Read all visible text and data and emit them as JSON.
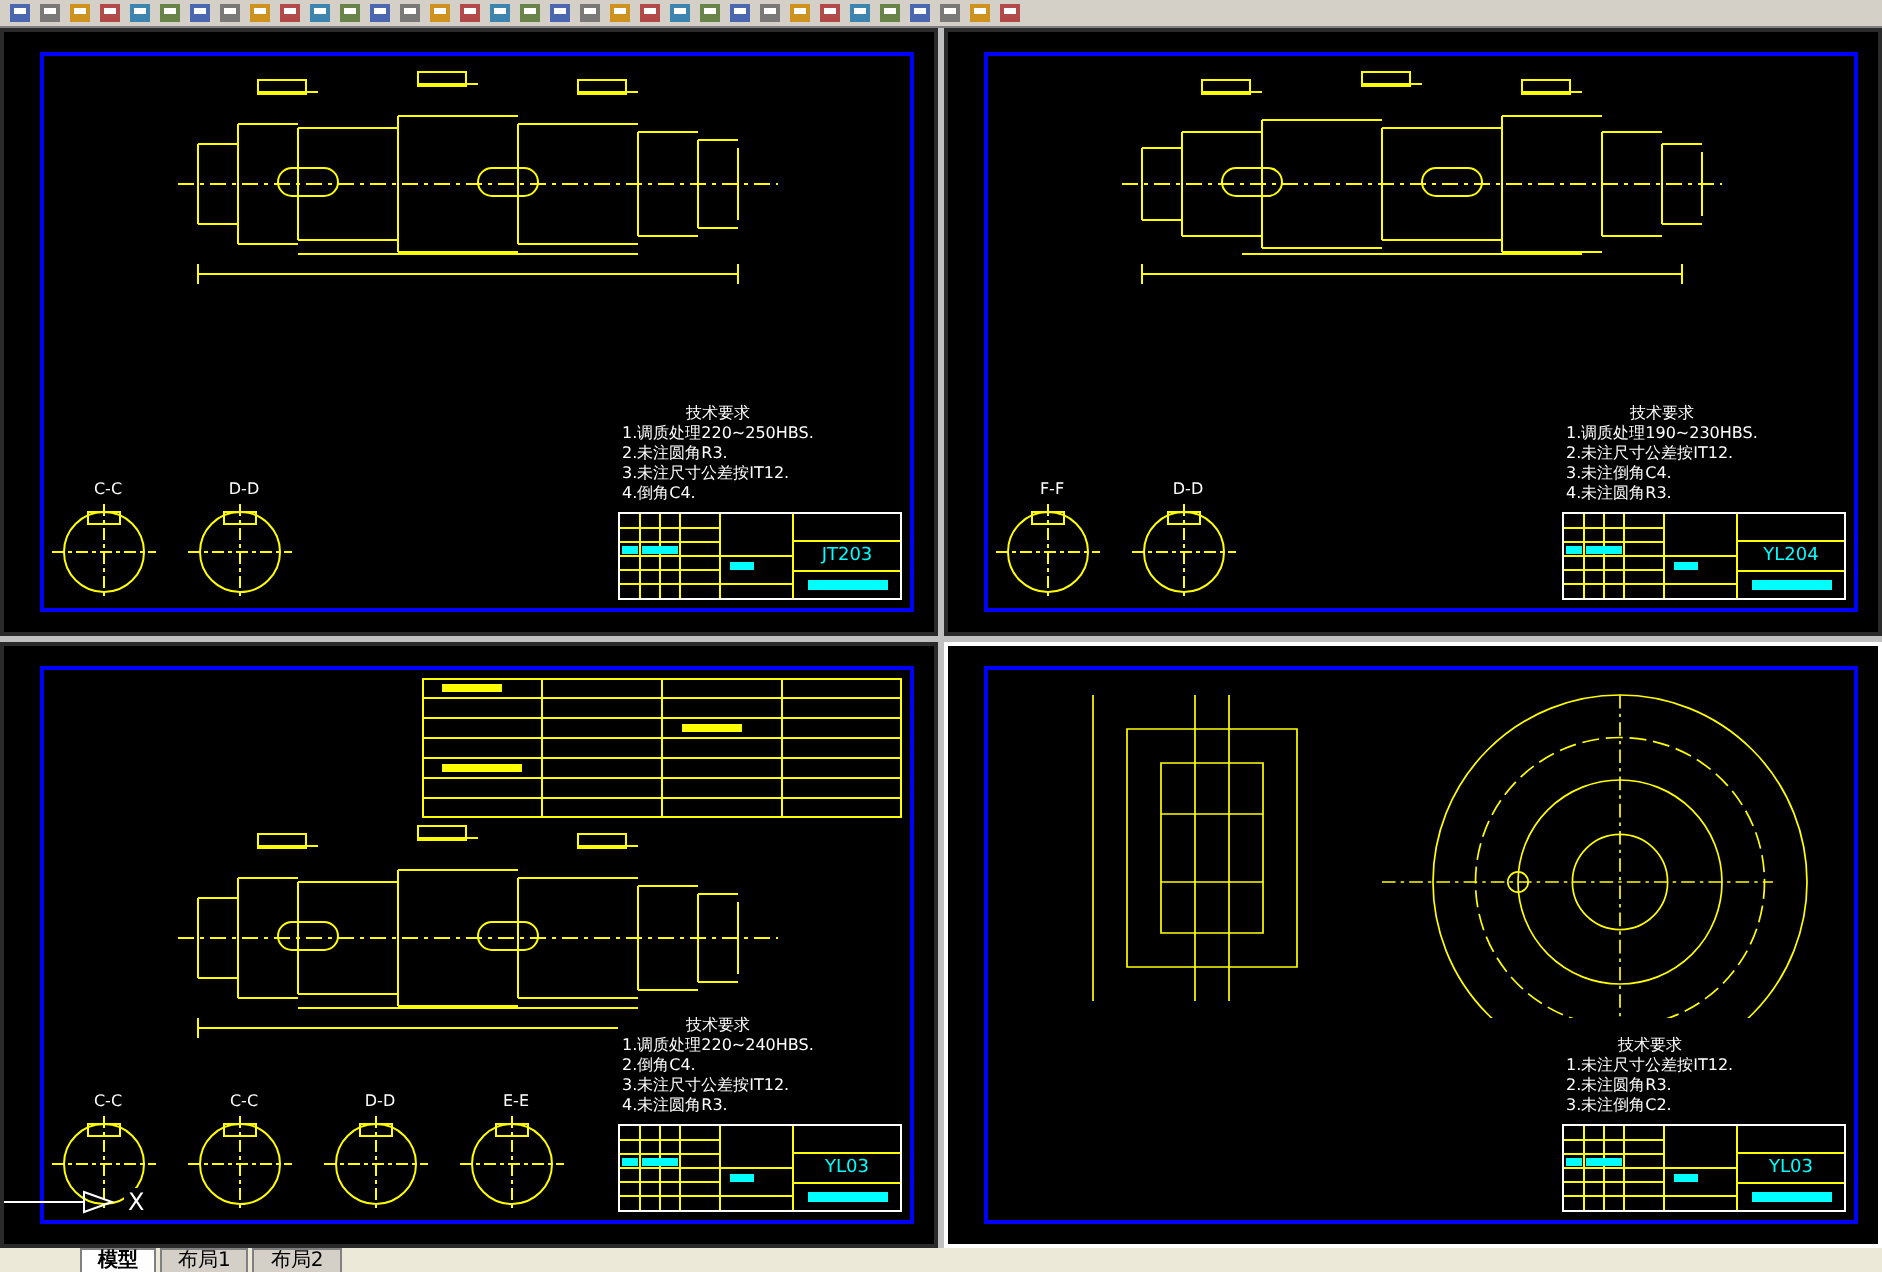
{
  "viewports": [
    {
      "kind": "shaft",
      "sections": [
        "C-C",
        "D-D"
      ],
      "notes_title": "技术要求",
      "notes": [
        "1.调质处理220~250HBS.",
        "2.未注圆角R3.",
        "3.未注尺寸公差按IT12.",
        "4.倒角C4."
      ],
      "drawing_no": "JT203",
      "selected": false
    },
    {
      "kind": "shaft",
      "sections": [
        "F-F",
        "D-D"
      ],
      "notes_title": "技术要求",
      "notes": [
        "1.调质处理190~230HBS.",
        "2.未注尺寸公差按IT12.",
        "3.未注倒角C4.",
        "4.未注圆角R3."
      ],
      "drawing_no": "YL204",
      "selected": false
    },
    {
      "kind": "gear_shaft",
      "sections": [
        "C-C",
        "C-C",
        "D-D",
        "E-E"
      ],
      "notes_title": "技术要求",
      "notes": [
        "1.调质处理220~240HBS.",
        "2.倒角C4.",
        "3.未注尺寸公差按IT12.",
        "4.未注圆角R3."
      ],
      "drawing_no": "YL03",
      "selected": false
    },
    {
      "kind": "wheel",
      "notes_title": "技术要求",
      "notes": [
        "1.未注尺寸公差按IT12.",
        "2.未注圆角R3.",
        "3.未注倒角C2."
      ],
      "drawing_no": "YL03",
      "selected": true
    }
  ],
  "ucs": {
    "axis": "X"
  },
  "tabs": [
    {
      "label": "模型",
      "selected": true
    },
    {
      "label": "布局1",
      "selected": false
    },
    {
      "label": "布局2",
      "selected": false
    }
  ]
}
